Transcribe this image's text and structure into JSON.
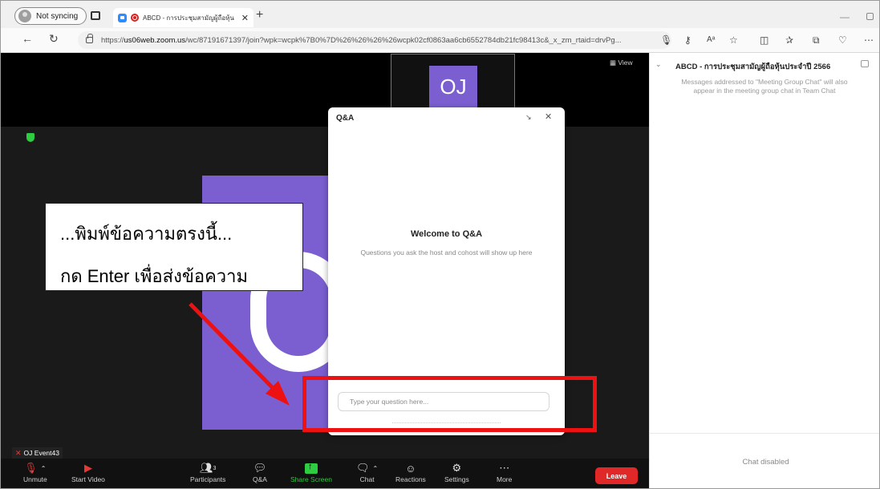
{
  "browser": {
    "profile_label": "Not syncing",
    "tab_title": "ABCD - การประชุมสามัญผู้ถือหุ้น",
    "new_tab": "+",
    "url_prefix": "https://",
    "url_host": "us06web.zoom.us",
    "url_rest": "/wc/87191671397/join?wpk=wcpk%7B0%7D%26%26%26%26wcpk02cf0863aa6cb6552784db21fc98413c&_x_zm_rtaid=drvPg..."
  },
  "meeting": {
    "view_label": "View",
    "thumb_initials": "OJ",
    "participant_name": "OJ Event43"
  },
  "callout": {
    "line1": "...พิมพ์ข้อความตรงนี้...",
    "line2": "กด Enter เพื่อส่งข้อความ"
  },
  "qa": {
    "title": "Q&A",
    "welcome": "Welcome to Q&A",
    "description": "Questions you ask the host and cohost will show up here",
    "input_placeholder": "Type your question here..."
  },
  "toolbar": {
    "unmute": "Unmute",
    "start_video": "Start Video",
    "participants": "Participants",
    "participants_count": "3",
    "qa": "Q&A",
    "share_screen": "Share Screen",
    "chat": "Chat",
    "reactions": "Reactions",
    "settings": "Settings",
    "more": "More",
    "leave": "Leave"
  },
  "chat": {
    "title": "ABCD - การประชุมสามัญผู้ถือหุ้นประจำปี 2566",
    "note": "Messages addressed to \"Meeting Group Chat\" will also appear in the meeting group chat in Team Chat",
    "disabled": "Chat disabled"
  },
  "colors": {
    "zoom_purple": "#7b5fd1",
    "leave_red": "#e02828",
    "share_green": "#2ecc40",
    "annotation_red": "#ee1111"
  }
}
